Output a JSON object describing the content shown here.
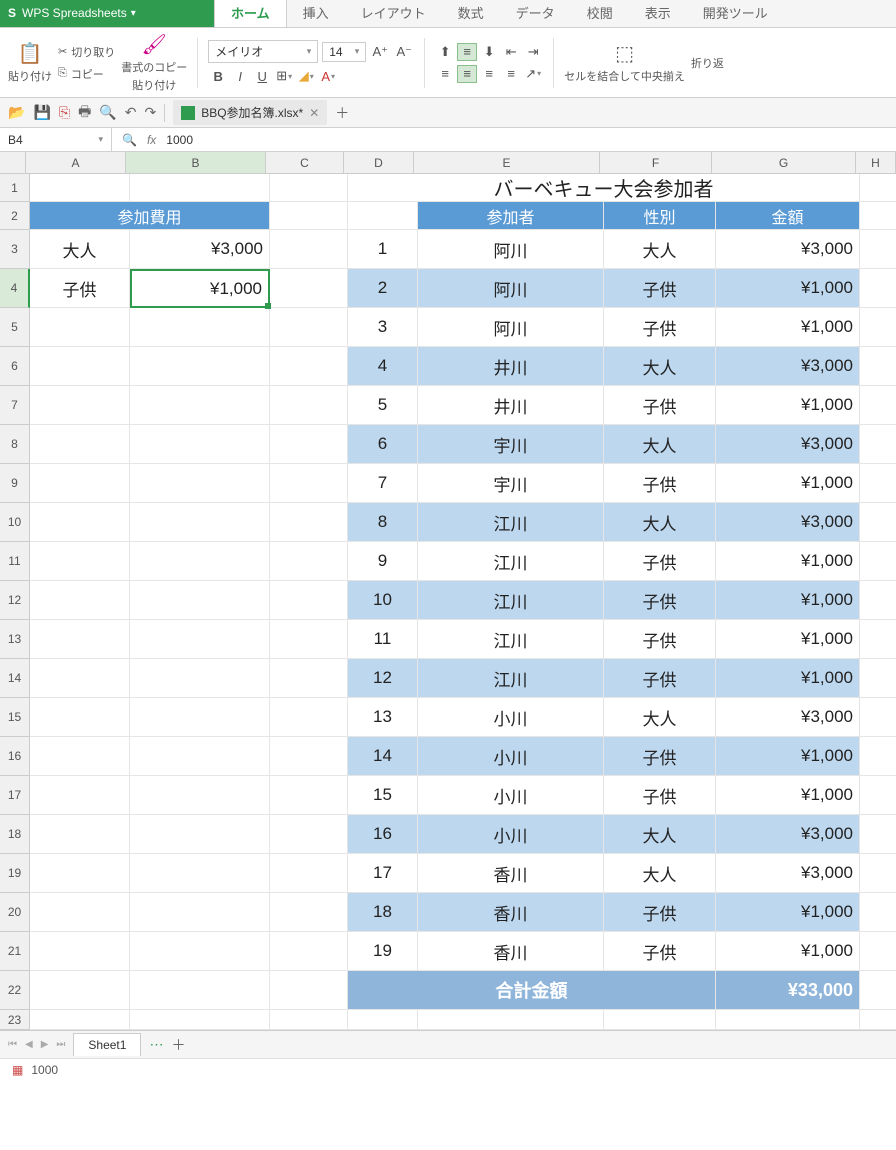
{
  "app": {
    "title": "WPS Spreadsheets"
  },
  "menutabs": [
    "ホーム",
    "挿入",
    "レイアウト",
    "数式",
    "データ",
    "校閲",
    "表示",
    "開発ツール"
  ],
  "ribbon": {
    "paste": "貼り付け",
    "cut": "切り取り",
    "copy": "コピー",
    "formatpaint1": "書式のコピー",
    "formatpaint2": "貼り付け",
    "font": "メイリオ",
    "size": "14",
    "merge": "セルを結合して中央揃え",
    "wrap": "折り返"
  },
  "doctab": "BBQ参加名簿.xlsx*",
  "namebox": "B4",
  "formula": "1000",
  "colheads": [
    "A",
    "B",
    "C",
    "D",
    "E",
    "F",
    "G",
    "H"
  ],
  "rowcount": 23,
  "title": "バーベキュー大会参加者",
  "feeHeader": "参加費用",
  "feeRows": [
    {
      "label": "大人",
      "price": "¥3,000"
    },
    {
      "label": "子供",
      "price": "¥1,000"
    }
  ],
  "listHeaders": {
    "name": "参加者",
    "sex": "性別",
    "amt": "金額"
  },
  "listRows": [
    {
      "n": "1",
      "name": "阿川",
      "sex": "大人",
      "amt": "¥3,000"
    },
    {
      "n": "2",
      "name": "阿川",
      "sex": "子供",
      "amt": "¥1,000"
    },
    {
      "n": "3",
      "name": "阿川",
      "sex": "子供",
      "amt": "¥1,000"
    },
    {
      "n": "4",
      "name": "井川",
      "sex": "大人",
      "amt": "¥3,000"
    },
    {
      "n": "5",
      "name": "井川",
      "sex": "子供",
      "amt": "¥1,000"
    },
    {
      "n": "6",
      "name": "宇川",
      "sex": "大人",
      "amt": "¥3,000"
    },
    {
      "n": "7",
      "name": "宇川",
      "sex": "子供",
      "amt": "¥1,000"
    },
    {
      "n": "8",
      "name": "江川",
      "sex": "大人",
      "amt": "¥3,000"
    },
    {
      "n": "9",
      "name": "江川",
      "sex": "子供",
      "amt": "¥1,000"
    },
    {
      "n": "10",
      "name": "江川",
      "sex": "子供",
      "amt": "¥1,000"
    },
    {
      "n": "11",
      "name": "江川",
      "sex": "子供",
      "amt": "¥1,000"
    },
    {
      "n": "12",
      "name": "江川",
      "sex": "子供",
      "amt": "¥1,000"
    },
    {
      "n": "13",
      "name": "小川",
      "sex": "大人",
      "amt": "¥3,000"
    },
    {
      "n": "14",
      "name": "小川",
      "sex": "子供",
      "amt": "¥1,000"
    },
    {
      "n": "15",
      "name": "小川",
      "sex": "子供",
      "amt": "¥1,000"
    },
    {
      "n": "16",
      "name": "小川",
      "sex": "大人",
      "amt": "¥3,000"
    },
    {
      "n": "17",
      "name": "香川",
      "sex": "大人",
      "amt": "¥3,000"
    },
    {
      "n": "18",
      "name": "香川",
      "sex": "子供",
      "amt": "¥1,000"
    },
    {
      "n": "19",
      "name": "香川",
      "sex": "子供",
      "amt": "¥1,000"
    }
  ],
  "totalLabel": "合計金額",
  "totalValue": "¥33,000",
  "sheet": "Sheet1",
  "status": "1000"
}
